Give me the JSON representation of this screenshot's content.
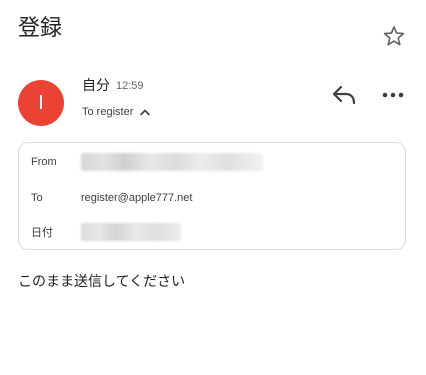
{
  "email": {
    "subject": "登録",
    "sender": {
      "name": "自分",
      "avatar_initial": "I",
      "avatar_color": "#ea4335",
      "time": "12:59"
    },
    "recipient_summary": "To register",
    "details": {
      "from_label": "From",
      "to_label": "To",
      "to_value": "register@apple777.net",
      "date_label": "日付"
    },
    "body": "このまま送信してください"
  },
  "icons": {
    "star": "star-outline-icon",
    "reply": "reply-icon",
    "more": "more-horizontal-icon",
    "expand": "chevron-up-icon"
  }
}
